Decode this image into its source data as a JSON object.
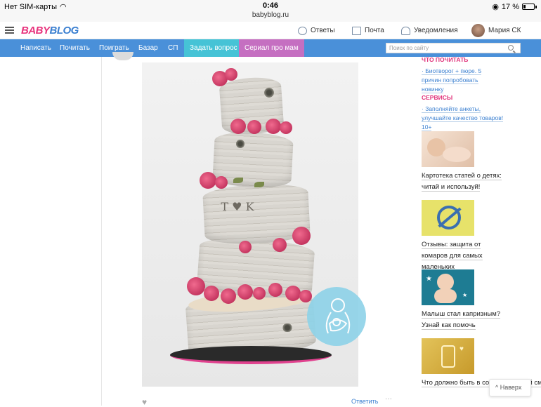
{
  "status_bar": {
    "carrier": "Нет SIM-карты",
    "time": "0:46",
    "url": "babyblog.ru",
    "battery": "17 %"
  },
  "header": {
    "logo_part1": "BABY",
    "logo_part2": "BLOG",
    "answers": "Ответы",
    "mail": "Почта",
    "notifications": "Уведомления",
    "user": "Мария СК"
  },
  "nav": {
    "items": [
      "Написать",
      "Почитать",
      "Поиграть",
      "Базар",
      "СП"
    ],
    "ask": "Задать вопрос",
    "serial": "Сериал про мам",
    "search_placeholder": "Поиск по сайту"
  },
  "post": {
    "carving": "T ♥ K",
    "reply": "Ответить",
    "more": "···"
  },
  "sidebar": {
    "read_head": "ЧТО ПОЧИТАТЬ",
    "read_link": "· Биотворог + пюре. 5 причин попробовать новинку",
    "services_head": "СЕРВИСЫ",
    "services_link": "· Заполняйте анкеты, улучшайте качество товаров! 10+",
    "cards": [
      {
        "title": "Картотека статей о детях: читай и используй!"
      },
      {
        "title": "Отзывы: защита от комаров для самых маленьких"
      },
      {
        "title": "Малыш стал капризным? Узнай как помочь"
      },
      {
        "title": "Что должно быть в составе детской смеси? Изучи!"
      }
    ]
  },
  "back_button": "^ Наверх",
  "colors": {
    "nav_blue": "#4a90d9",
    "ask_teal": "#46c3d6",
    "serial_purple": "#c56fc1",
    "brand_pink": "#e8327c",
    "brand_blue": "#3a7fd0"
  }
}
